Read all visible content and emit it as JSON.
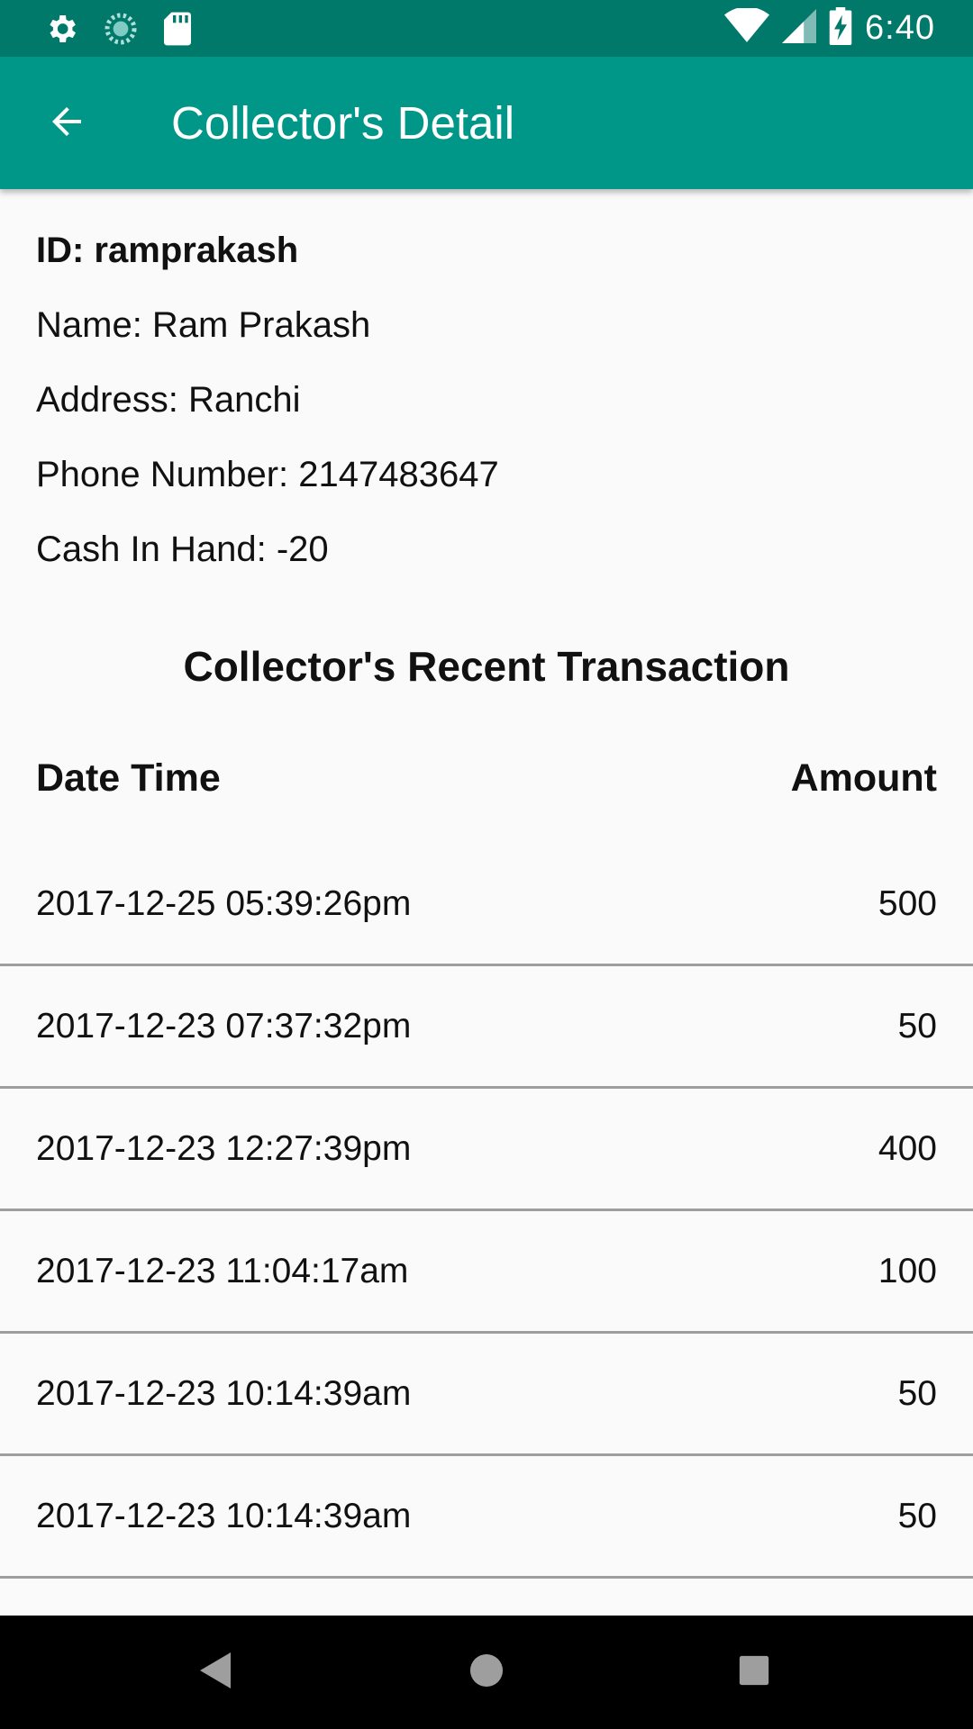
{
  "status_bar": {
    "time": "6:40",
    "icons": [
      "settings-icon",
      "sync-icon",
      "sd-card-icon",
      "wifi-icon",
      "cell-signal-icon",
      "battery-charging-icon"
    ]
  },
  "app_bar": {
    "title": "Collector's Detail",
    "back_icon": "arrow-back-icon",
    "color": "#009688",
    "status_color": "#00796b"
  },
  "collector": {
    "id": "ID: ramprakash",
    "name": "Name: Ram Prakash",
    "address": "Address: Ranchi",
    "phone": "Phone Number: 2147483647",
    "cash_in_hand": "Cash In Hand: -20"
  },
  "transactions": {
    "title": "Collector's Recent Transaction",
    "headers": [
      "Date Time",
      "Amount"
    ],
    "rows": [
      {
        "datetime": "2017-12-25 05:39:26pm",
        "amount": "500"
      },
      {
        "datetime": "2017-12-23 07:37:32pm",
        "amount": "50"
      },
      {
        "datetime": "2017-12-23 12:27:39pm",
        "amount": "400"
      },
      {
        "datetime": "2017-12-23 11:04:17am",
        "amount": "100"
      },
      {
        "datetime": "2017-12-23 10:14:39am",
        "amount": "50"
      },
      {
        "datetime": "2017-12-23 10:14:39am",
        "amount": "50"
      }
    ]
  },
  "nav_bar": {
    "buttons": [
      "back-triangle-icon",
      "home-circle-icon",
      "recents-square-icon"
    ]
  }
}
